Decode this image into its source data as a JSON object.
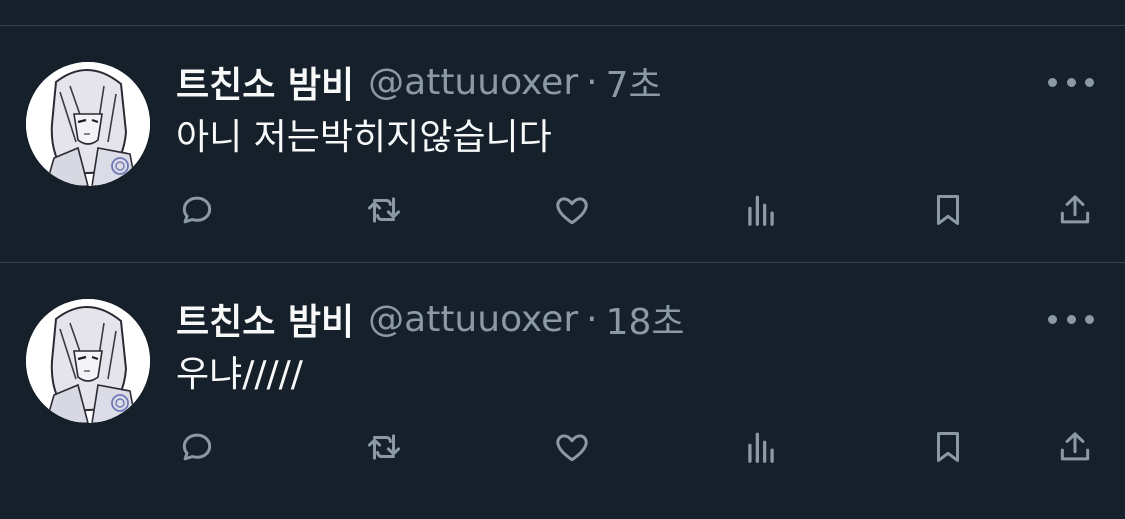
{
  "tweets": [
    {
      "display_name": "트친소 밤비",
      "handle": "@attuuoxer",
      "separator": "·",
      "time": "7초",
      "text": "아니 저는박히지않습니다"
    },
    {
      "display_name": "트친소 밤비",
      "handle": "@attuuoxer",
      "separator": "·",
      "time": "18초",
      "text": "우냐/////"
    }
  ],
  "icons": {
    "more": "more-horizontal-icon",
    "reply": "reply-bubble-icon",
    "retweet": "retweet-icon",
    "like": "heart-icon",
    "views": "bar-chart-icon",
    "bookmark": "bookmark-icon",
    "share": "share-upload-icon"
  },
  "colors": {
    "background": "#15202b",
    "primary_text": "#f7f9f9",
    "secondary_text": "#8b98a5",
    "divider": "#38444d"
  }
}
